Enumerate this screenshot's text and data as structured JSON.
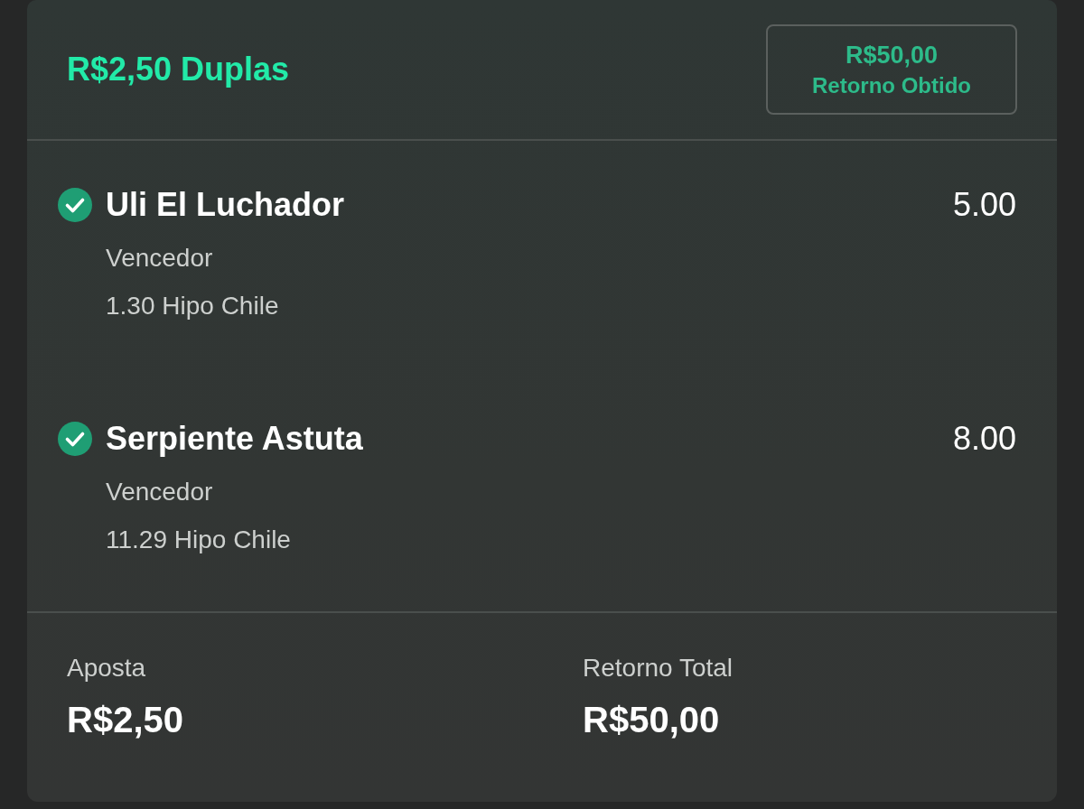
{
  "header": {
    "title": "R$2,50 Duplas",
    "return_box": {
      "amount": "R$50,00",
      "label": "Retorno Obtido"
    }
  },
  "selections": [
    {
      "name": "Uli El Luchador",
      "won": true,
      "odds": "5.00",
      "market": "Vencedor",
      "detail": "1.30 Hipo Chile"
    },
    {
      "name": "Serpiente Astuta",
      "won": true,
      "odds": "8.00",
      "market": "Vencedor",
      "detail": "11.29 Hipo Chile"
    }
  ],
  "footer": [
    {
      "label": "Aposta",
      "value": "R$2,50"
    },
    {
      "label": "Retorno Total",
      "value": "R$50,00"
    }
  ]
}
